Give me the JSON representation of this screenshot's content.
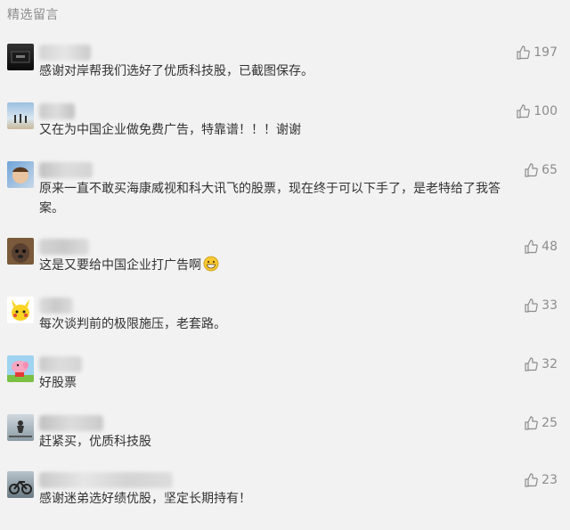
{
  "header": {
    "title": "精选留言"
  },
  "comments": [
    {
      "text": "感谢对岸帮我们选好了优质科技股，已截图保存。",
      "likes": "197",
      "avatar_icon": "dark-screen-avatar"
    },
    {
      "text": "又在为中国企业做免费广告，特靠谱！！！谢谢",
      "likes": "100",
      "avatar_icon": "beach-people-avatar"
    },
    {
      "text": "原来一直不敢买海康威视和科大讯飞的股票，现在终于可以下手了，是老特给了我答案。",
      "likes": "65",
      "avatar_icon": "child-photo-avatar"
    },
    {
      "text": "这是又要给中国企业打广告啊",
      "likes": "48",
      "avatar_icon": "dog-face-avatar",
      "emoji": "grin-emoji"
    },
    {
      "text": "每次谈判前的极限施压，老套路。",
      "likes": "33",
      "avatar_icon": "pikachu-avatar"
    },
    {
      "text": "好股票",
      "likes": "32",
      "avatar_icon": "peppa-pig-avatar"
    },
    {
      "text": "赶紧买，优质科技股",
      "likes": "25",
      "avatar_icon": "rider-avatar"
    },
    {
      "text": "感谢迷弟选好绩优股，坚定长期持有！",
      "likes": "23",
      "avatar_icon": "motorcycle-avatar"
    }
  ]
}
